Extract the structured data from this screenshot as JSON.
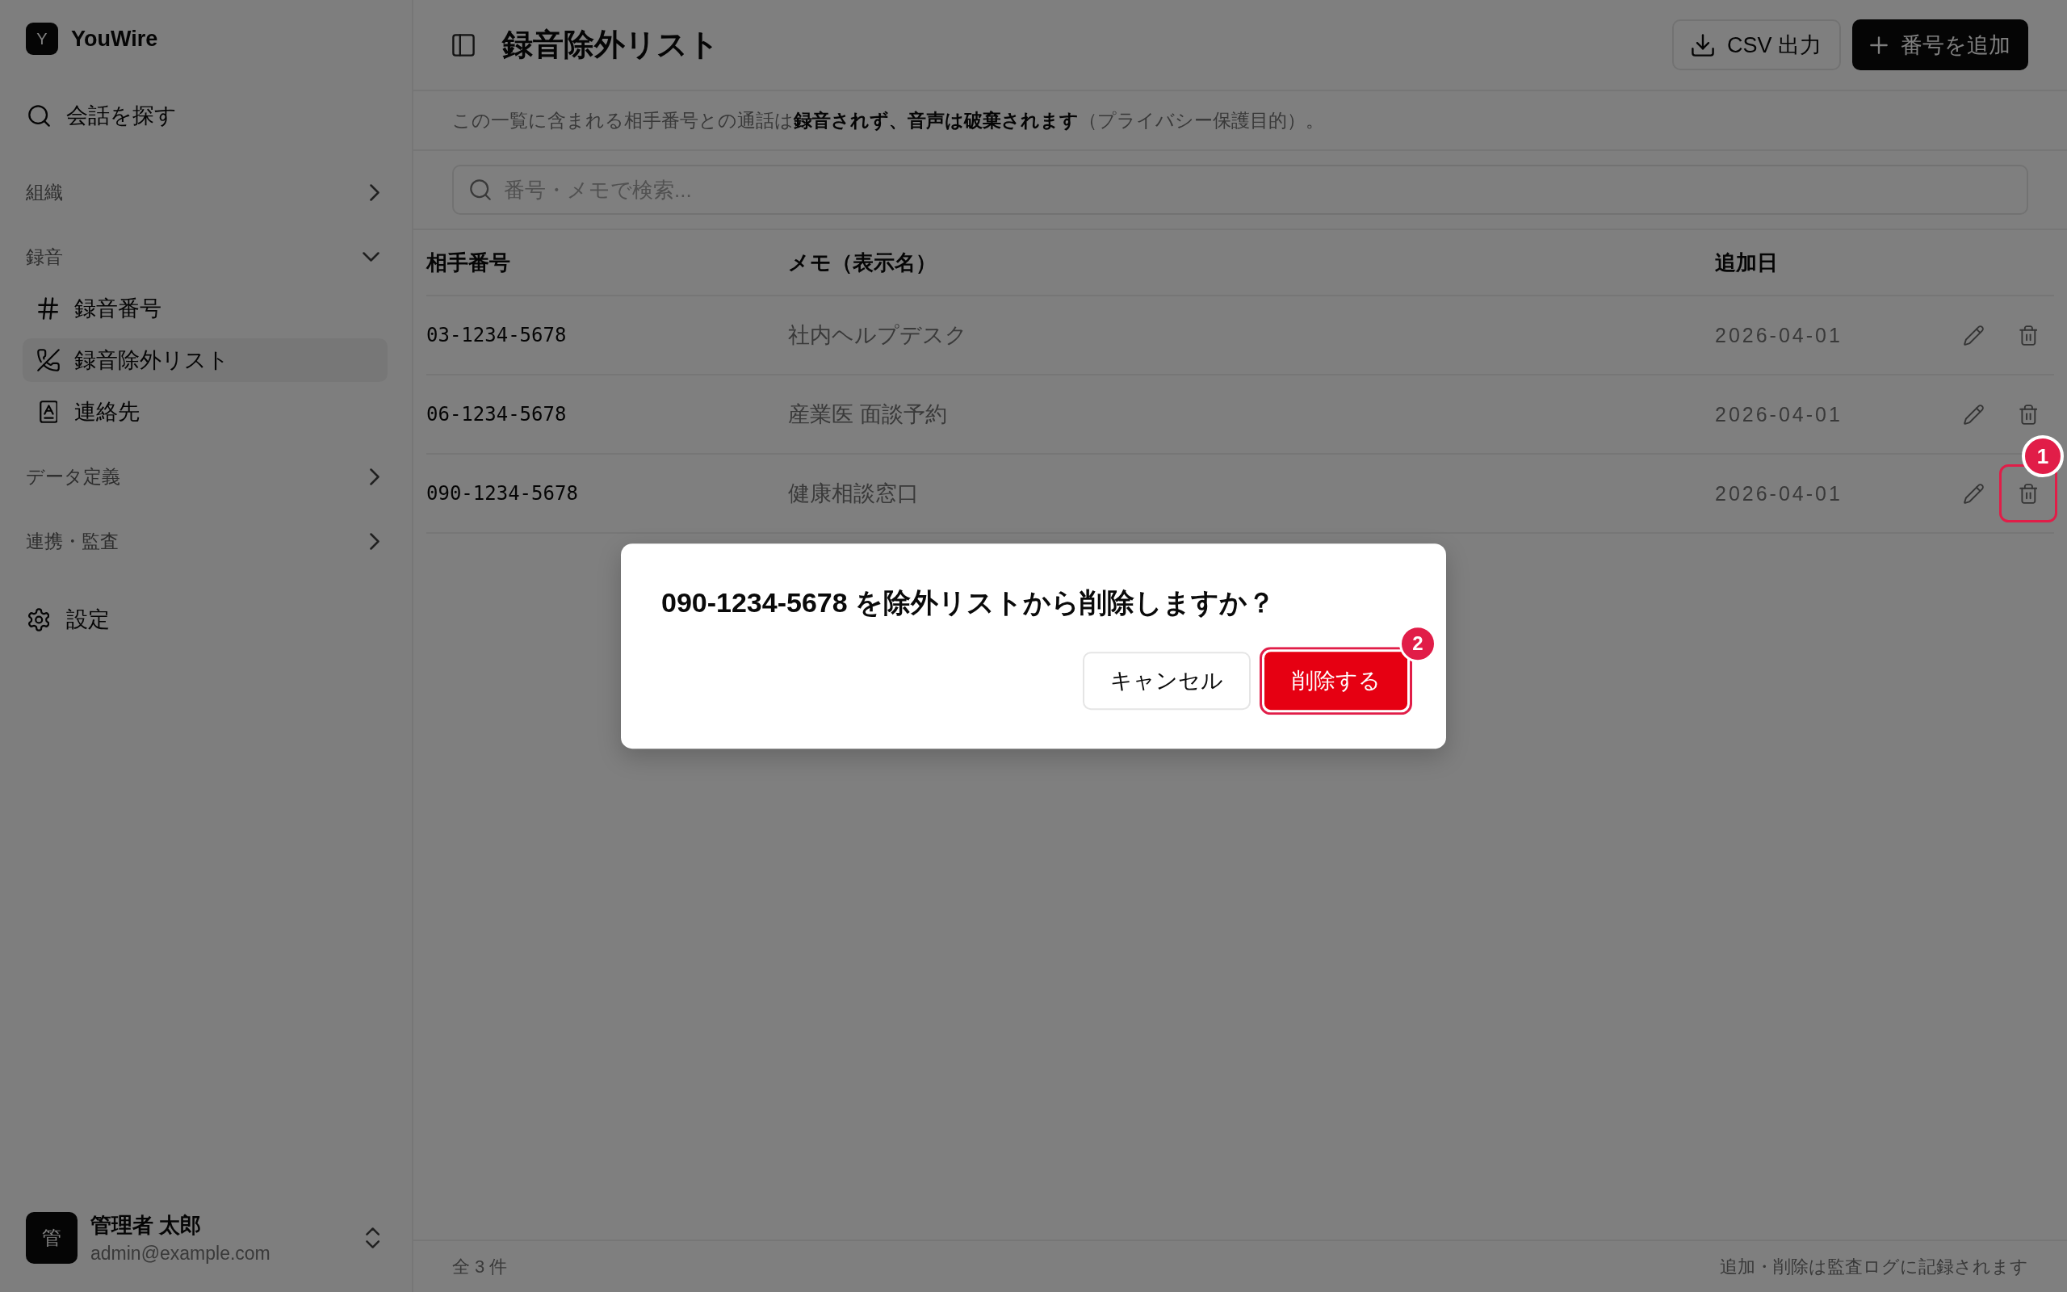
{
  "sidebar": {
    "brand": {
      "logo": "Y",
      "name": "YouWire"
    },
    "search_link": {
      "label": "会話を探す"
    },
    "sections": [
      {
        "label": "組織",
        "expanded": false
      },
      {
        "label": "録音",
        "expanded": true,
        "items": [
          {
            "label": "録音番号",
            "kind": "hash",
            "selected": false
          },
          {
            "label": "録音除外リスト",
            "kind": "phone-off",
            "selected": true
          },
          {
            "label": "連絡先",
            "kind": "contact",
            "selected": false
          }
        ]
      },
      {
        "label": "データ定義",
        "expanded": false
      },
      {
        "label": "連携・監査",
        "expanded": false
      }
    ],
    "settings_link": {
      "label": "設定"
    },
    "user": {
      "avatar": "管",
      "name": "管理者 太郎",
      "email": "admin@example.com"
    }
  },
  "header": {
    "title": "録音除外リスト",
    "buttons": [
      {
        "label": "CSV 出力",
        "kind": "export"
      },
      {
        "label": "番号を追加",
        "kind": "add"
      }
    ]
  },
  "notice": "この一覧に含まれる相手番号との通話は**録音されず、音声は破棄されます**（プライバシー保護目的）。",
  "search": {
    "placeholder": "番号・メモで検索..."
  },
  "table": {
    "columns": [
      "相手番号",
      "メモ（表示名）",
      "追加日"
    ],
    "rows": [
      {
        "number": "03-1234-5678",
        "memo": "社内ヘルプデスク",
        "added": "2026-04-01"
      },
      {
        "number": "06-1234-5678",
        "memo": "産業医 面談予約",
        "added": "2026-04-01"
      },
      {
        "number": "090-1234-5678",
        "memo": "健康相談窓口",
        "added": "2026-04-01",
        "callout": "1"
      }
    ]
  },
  "footer": {
    "count": "全 3 件",
    "note": "追加・削除は監査ログに記録されます"
  },
  "dialog": {
    "message": "090-1234-5678 を除外リストから削除しますか？",
    "buttons": [
      {
        "label": "キャンセル",
        "kind": "cancel"
      },
      {
        "label": "削除する",
        "kind": "danger",
        "callout": "2"
      }
    ]
  }
}
